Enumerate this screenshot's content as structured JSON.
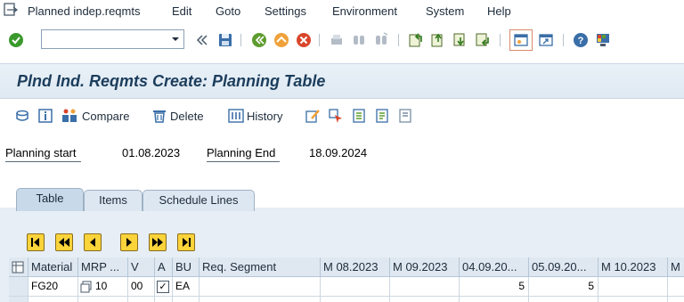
{
  "menu": {
    "items": [
      "Planned indep.reqmts",
      "Edit",
      "Goto",
      "Settings",
      "Environment",
      "System",
      "Help"
    ]
  },
  "toolbar": {
    "command_field_value": "",
    "icons": [
      "enter-icon",
      "save-icon",
      "back-icon",
      "exit-icon",
      "cancel-icon",
      "print-icon",
      "find-icon",
      "find-next-icon",
      "first-page-icon",
      "prev-page-icon",
      "next-page-icon",
      "last-page-icon",
      "new-session-icon",
      "shortcut-icon",
      "help-icon",
      "customize-layout-icon"
    ]
  },
  "title": "Plnd Ind. Reqmts Create: Planning Table",
  "app_toolbar": {
    "compare_label": "Compare",
    "delete_label": "Delete",
    "history_label": "History"
  },
  "header": {
    "planning_start_label": "Planning start",
    "planning_start_value": "01.08.2023",
    "planning_end_label": "Planning End",
    "planning_end_value": "18.09.2024"
  },
  "tabs": [
    "Table",
    "Items",
    "Schedule Lines"
  ],
  "table": {
    "columns": [
      "Material",
      "MRP ...",
      "V",
      "A",
      "BU",
      "Req. Segment",
      "M 08.2023",
      "M 09.2023",
      "04.09.20...",
      "05.09.20...",
      "M 10.2023",
      "M"
    ],
    "rows": [
      {
        "material": "FG20",
        "mrp": "10",
        "v": "00",
        "a": "✓",
        "bu": "EA",
        "req_segment": "",
        "m082023": "",
        "m092023": "",
        "d04092023": "5",
        "d05092023": "5",
        "m102023": "",
        "m": ""
      }
    ]
  },
  "colors": {
    "title_text": "#1c3d5c",
    "nav_button": "#fbd33a",
    "tab_area": "#e7eef5"
  }
}
